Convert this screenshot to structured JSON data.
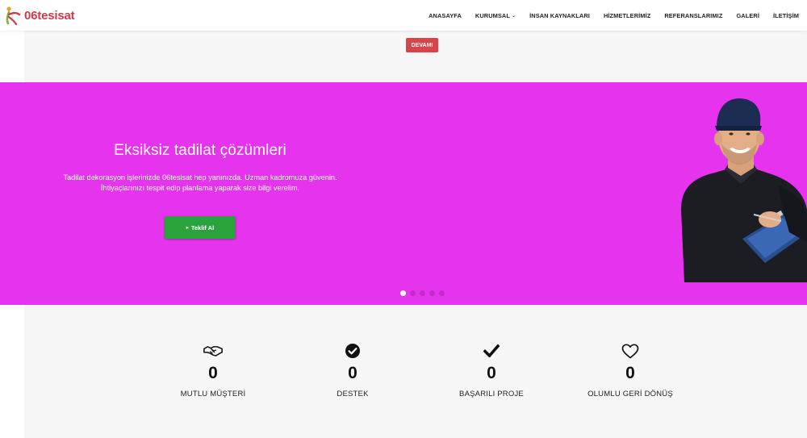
{
  "header": {
    "logo_text": "06tesisat",
    "nav": [
      {
        "label": "ANASAYFA"
      },
      {
        "label": "KURUMSAL",
        "has_dropdown": true
      },
      {
        "label": "İNSAN KAYNAKLARI"
      },
      {
        "label": "HİZMETLERİMİZ"
      },
      {
        "label": "REFERANSLARIMIZ"
      },
      {
        "label": "GALERİ"
      },
      {
        "label": "İLETİŞİM"
      }
    ]
  },
  "top_section": {
    "more_button": "DEVAMI"
  },
  "hero": {
    "background": "#e633ee",
    "title": "Eksiksiz tadilat çözümleri",
    "text": "Tadilat dekorasyon işlerinizde 06tesisat hep yanınızda. Uzman kadromuza güvenin. İhtiyaçlarınızı tespit edip planlama yaparak size bilgi verelim.",
    "cta_label": "Teklif Al",
    "cta_icon": "caret-right-icon",
    "slides_total": 5,
    "active_slide": 1
  },
  "stats": [
    {
      "icon": "handshake-icon",
      "value": "0",
      "label": "MUTLU MÜŞTERİ"
    },
    {
      "icon": "check-circle-icon",
      "value": "0",
      "label": "DESTEK"
    },
    {
      "icon": "check-icon",
      "value": "0",
      "label": "BAŞARILI PROJE"
    },
    {
      "icon": "heart-icon",
      "value": "0",
      "label": "OLUMLU GERİ DÖNÜŞ"
    }
  ],
  "colors": {
    "accent_red": "#d9444b",
    "hero_magenta": "#e633ee",
    "cta_green": "#2aa33c"
  }
}
